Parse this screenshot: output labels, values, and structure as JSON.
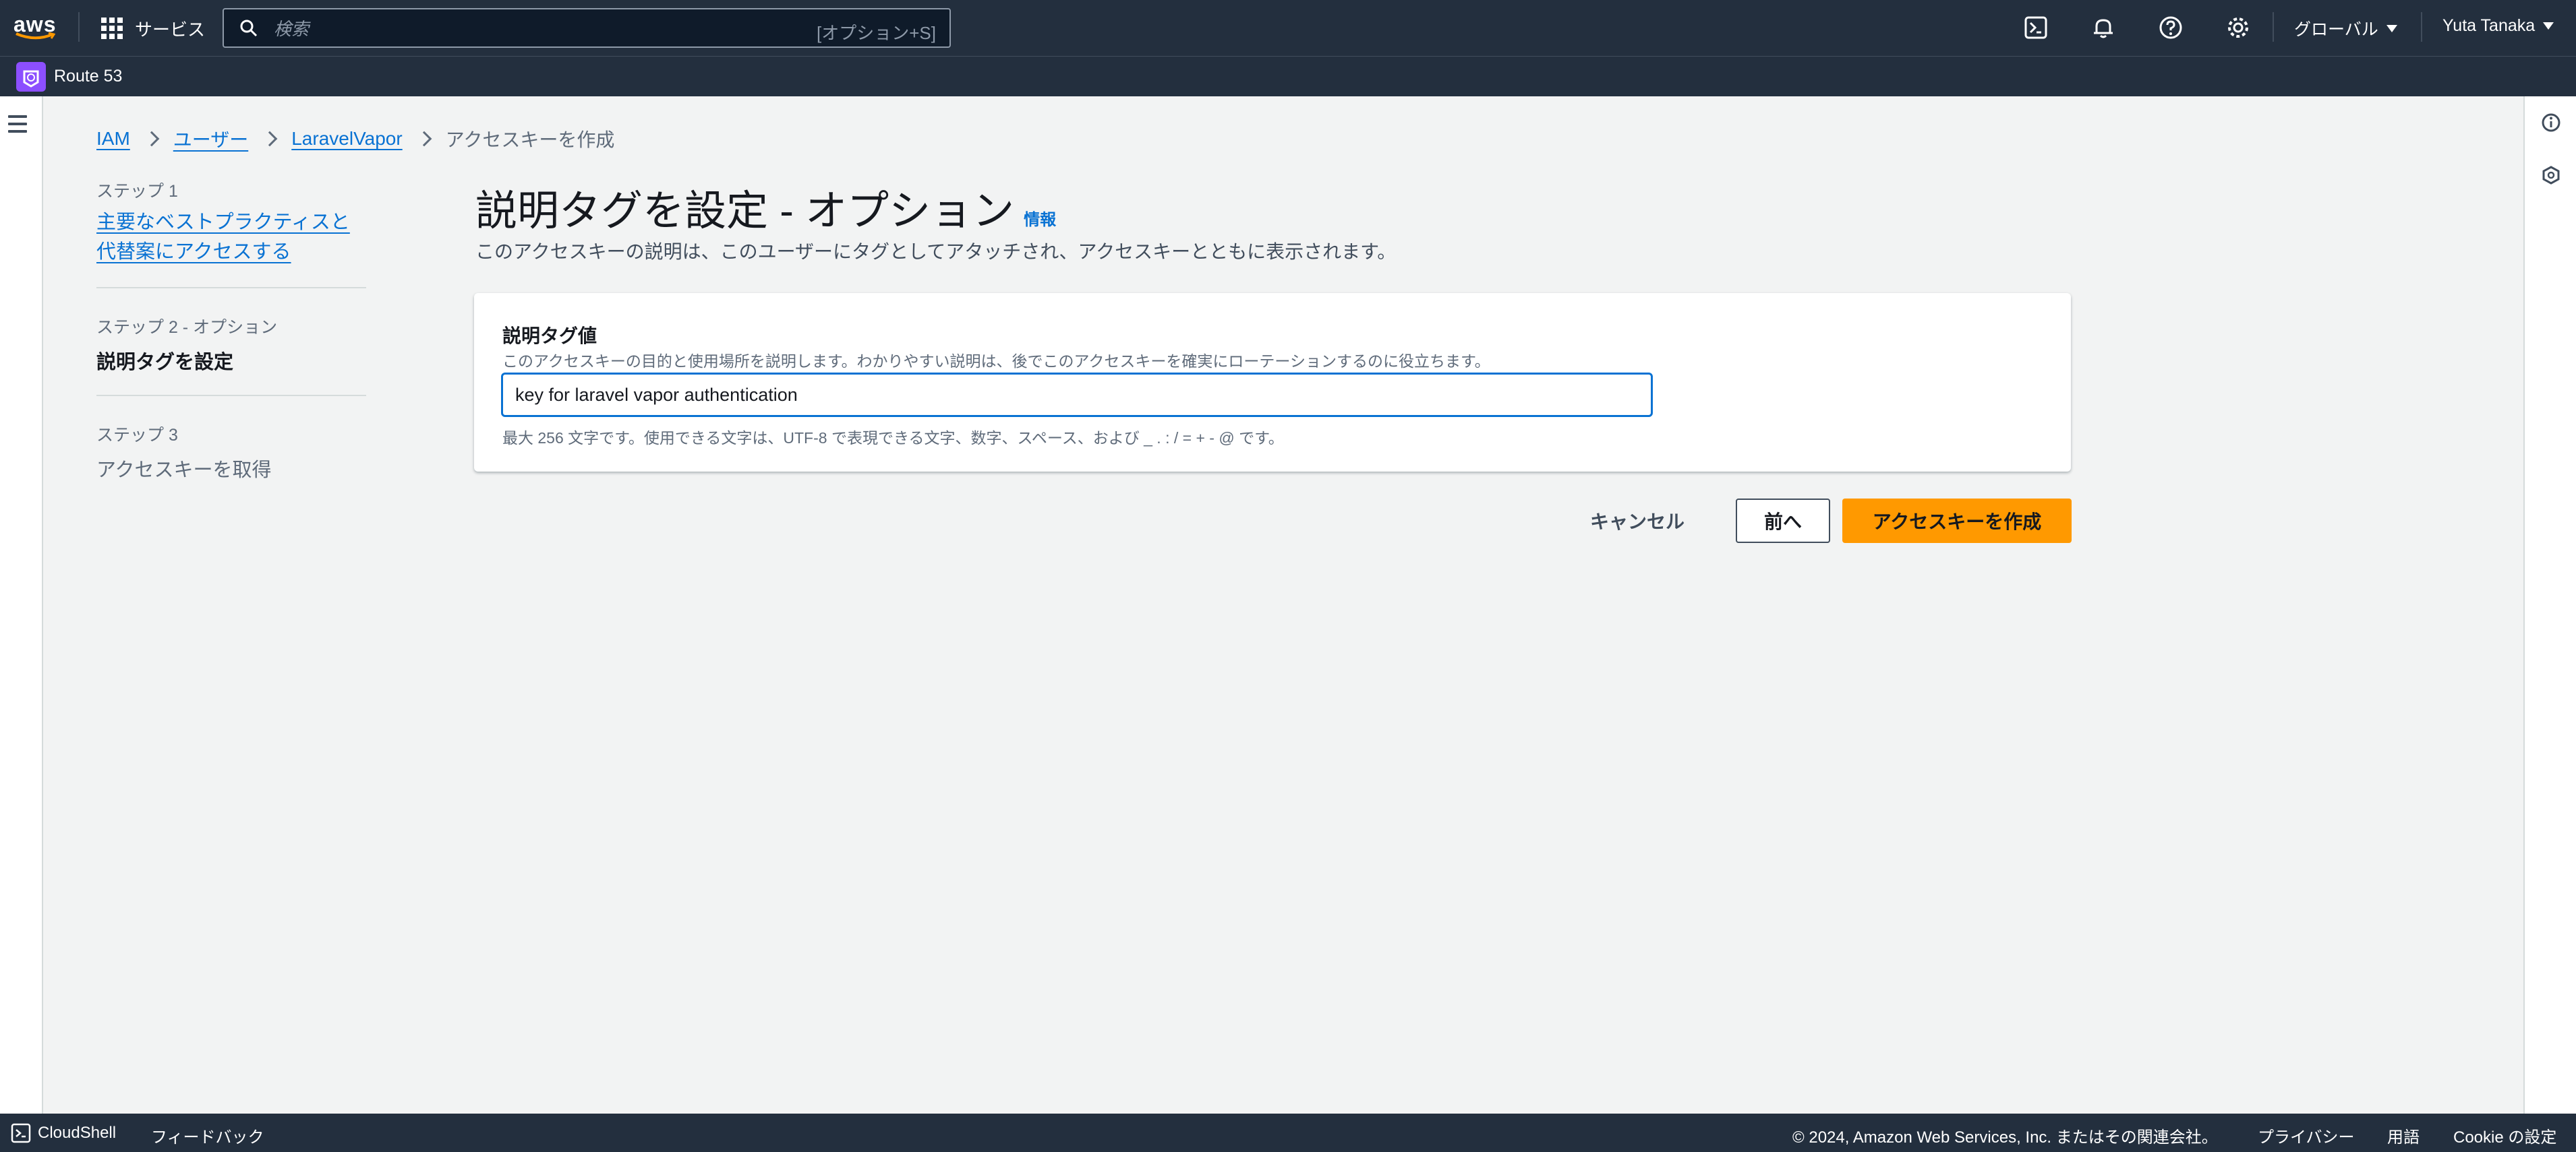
{
  "topnav": {
    "logo_text": "aws",
    "services_label": "サービス",
    "search_placeholder": "検索",
    "search_shortcut": "[オプション+S]",
    "region_label": "グローバル",
    "user_label": "Yuta Tanaka",
    "icons": [
      "cloudshell-icon",
      "bell-icon",
      "help-icon",
      "settings-icon"
    ]
  },
  "servicebar": {
    "service_label": "Route 53"
  },
  "breadcrumb": {
    "items": [
      "IAM",
      "ユーザー",
      "LaravelVapor"
    ],
    "current": "アクセスキーを作成"
  },
  "steps": {
    "step1_num": "ステップ 1",
    "step1_label": "主要なベストプラクティスと代替案にアクセスする",
    "step2_num": "ステップ 2 - オプション",
    "step2_label": "説明タグを設定",
    "step3_num": "ステップ 3",
    "step3_label": "アクセスキーを取得"
  },
  "main": {
    "title": "説明タグを設定 - オプション",
    "info_link": "情報",
    "description": "このアクセスキーの説明は、このユーザーにタグとしてアタッチされ、アクセスキーとともに表示されます。",
    "field_label": "説明タグ値",
    "field_description": "このアクセスキーの目的と使用場所を説明します。わかりやすい説明は、後でこのアクセスキーを確実にローテーションするのに役立ちます。",
    "field_value": "key for laravel vapor authentication",
    "field_hint": "最大 256 文字です。使用できる文字は、UTF-8 で表現できる文字、数字、スペース、および _ . : / = + - @ です。"
  },
  "actions": {
    "cancel": "キャンセル",
    "previous": "前へ",
    "create": "アクセスキーを作成"
  },
  "footer": {
    "cloudshell": "CloudShell",
    "feedback": "フィードバック",
    "copyright": "© 2024, Amazon Web Services, Inc. またはその関連会社。",
    "privacy": "プライバシー",
    "terms": "用語",
    "cookie": "Cookie の設定"
  },
  "colors": {
    "nav_bg": "#232f3e",
    "link": "#0972d3",
    "primary_button": "#ff9900",
    "service_badge": "#8c4fff"
  }
}
